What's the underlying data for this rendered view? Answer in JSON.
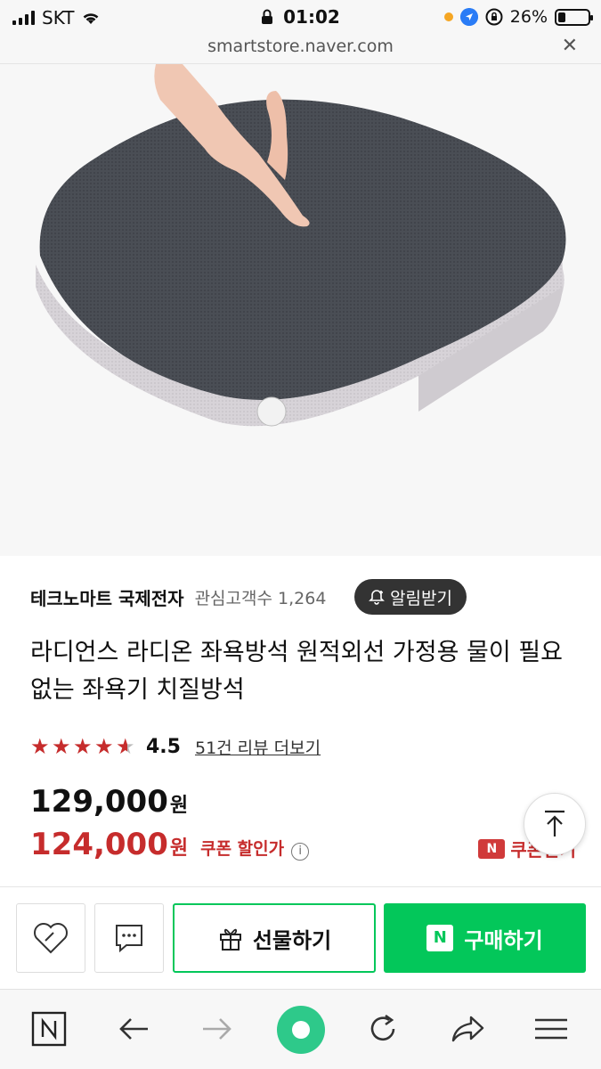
{
  "status_bar": {
    "carrier": "SKT",
    "time": "01:02",
    "battery": "26%",
    "battery_level": 0.26
  },
  "url_bar": {
    "url": "smartstore.naver.com",
    "close_icon": "close-icon"
  },
  "carousel": {
    "count": 5,
    "active_index": 0
  },
  "seller": {
    "name": "테크노마트 국제전자",
    "followers_label": "관심고객수 1,264",
    "alarm_button": "알림받기"
  },
  "product": {
    "title": "라디언스 라디온 좌욕방석 원적외선 가정용 물이 필요없는 좌욕기 치질방석",
    "rating": 4.5,
    "rating_text": "4.5",
    "review_link": "51건 리뷰 더보기",
    "original_price": "129,000",
    "original_unit": "원",
    "sale_price": "124,000",
    "sale_unit": "원",
    "coupon_label": "쿠폰 할인가",
    "npay_coupon": "쿠폰받기"
  },
  "actions": {
    "gift_label": "선물하기",
    "buy_label": "구매하기"
  },
  "colors": {
    "accent_green": "#03c75a",
    "sale_red": "#c62c2c"
  },
  "icons": {
    "wishlist": "heart-icon",
    "inquiry": "chat-bubble-icon",
    "gift": "gift-icon",
    "scroll_top": "arrow-up-icon"
  }
}
